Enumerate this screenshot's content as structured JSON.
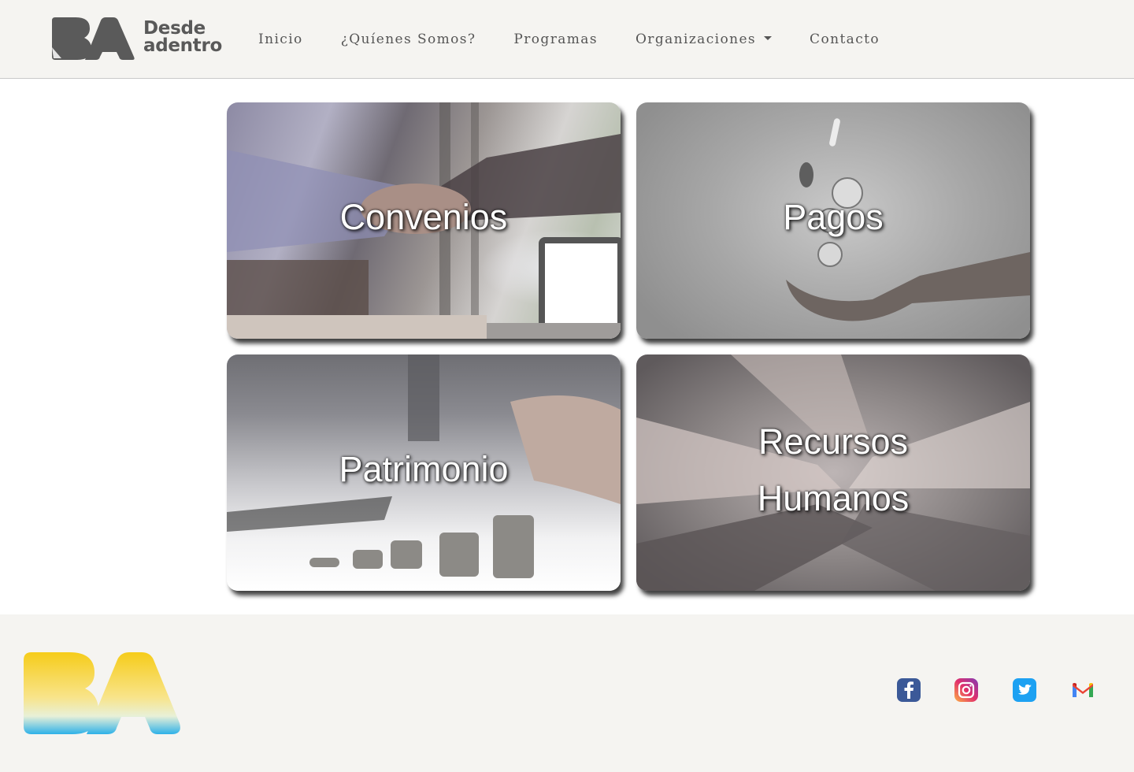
{
  "header": {
    "brand": {
      "line1": "Desde",
      "line2": "adentro"
    },
    "nav": [
      {
        "label": "Inicio"
      },
      {
        "label": "¿Quíenes Somos?"
      },
      {
        "label": "Programas"
      },
      {
        "label": "Organizaciones",
        "dropdown": true
      },
      {
        "label": "Contacto"
      }
    ]
  },
  "cards": {
    "convenios": {
      "title": "Convenios",
      "image": "handshake-photo"
    },
    "pagos": {
      "title": "Pagos",
      "image": "coins-falling-into-hand-photo"
    },
    "patrimonio": {
      "title": "Patrimonio",
      "image": "coin-stacks-photo"
    },
    "rrhh": {
      "title_line1": "Recursos",
      "title_line2": "Humanos",
      "image": "stacked-hands-photo"
    }
  },
  "footer": {
    "social": [
      {
        "name": "facebook-icon",
        "color": "#3b5998"
      },
      {
        "name": "instagram-icon",
        "color": "#e1306c"
      },
      {
        "name": "twitter-icon",
        "color": "#1da1f2"
      },
      {
        "name": "gmail-icon",
        "color": "#ea4335"
      }
    ]
  },
  "colors": {
    "header_bg": "#f5f4f1",
    "footer_bg": "#f5f4f1",
    "logo_gray": "#5a5a5a",
    "logo_yellow": "#f6cc1a",
    "logo_blue": "#3bb6e6"
  }
}
